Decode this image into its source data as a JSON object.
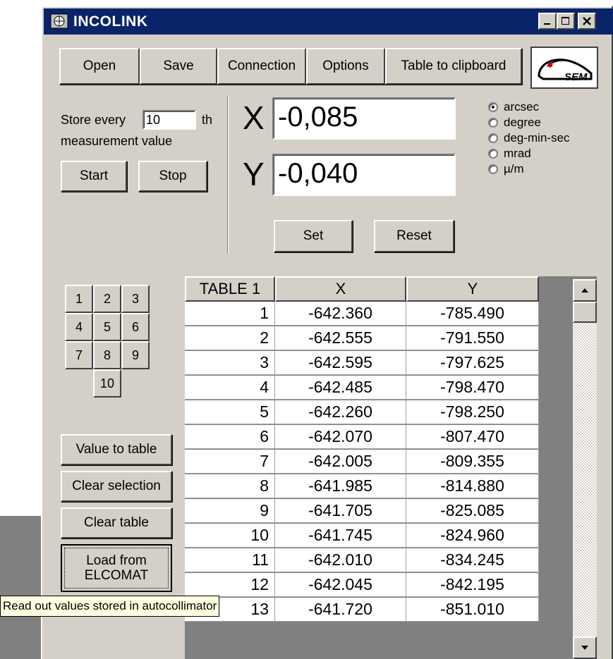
{
  "window": {
    "title": "INCOLINK"
  },
  "toolbar": {
    "open": "Open",
    "save": "Save",
    "connection": "Connection",
    "options": "Options",
    "table_to_clipboard": "Table to clipboard",
    "logo_text": "SEM"
  },
  "store": {
    "prefix": "Store every",
    "value": "10",
    "suffix": "th",
    "line2": "measurement value"
  },
  "controls": {
    "start": "Start",
    "stop": "Stop",
    "set": "Set",
    "reset": "Reset"
  },
  "readout": {
    "x_label": "X",
    "x_value": "-0,085",
    "y_label": "Y",
    "y_value": "-0,040"
  },
  "units": {
    "selected": "arcsec",
    "options": [
      "arcsec",
      "degree",
      "deg-min-sec",
      "mrad",
      "µ/m"
    ]
  },
  "keypad": [
    "1",
    "2",
    "3",
    "4",
    "5",
    "6",
    "7",
    "8",
    "9",
    "10"
  ],
  "actions": {
    "value_to_table": "Value to table",
    "clear_selection": "Clear selection",
    "clear_table": "Clear table",
    "load_line1": "Load from",
    "load_line2": "ELCOMAT"
  },
  "tooltip": "Read out values stored in autocollimator",
  "table": {
    "headers": [
      "TABLE 1",
      "X",
      "Y"
    ],
    "rows": [
      [
        "1",
        "-642.360",
        "-785.490"
      ],
      [
        "2",
        "-642.555",
        "-791.550"
      ],
      [
        "3",
        "-642.595",
        "-797.625"
      ],
      [
        "4",
        "-642.485",
        "-798.470"
      ],
      [
        "5",
        "-642.260",
        "-798.250"
      ],
      [
        "6",
        "-642.070",
        "-807.470"
      ],
      [
        "7",
        "-642.005",
        "-809.355"
      ],
      [
        "8",
        "-641.985",
        "-814.880"
      ],
      [
        "9",
        "-641.705",
        "-825.085"
      ],
      [
        "10",
        "-641.745",
        "-824.960"
      ],
      [
        "11",
        "-642.010",
        "-834.245"
      ],
      [
        "12",
        "-642.045",
        "-842.195"
      ],
      [
        "13",
        "-641.720",
        "-851.010"
      ]
    ]
  },
  "colors": {
    "titlebar": "#0a246a",
    "face": "#d4d0c8",
    "tooltip": "#ffffe1"
  }
}
